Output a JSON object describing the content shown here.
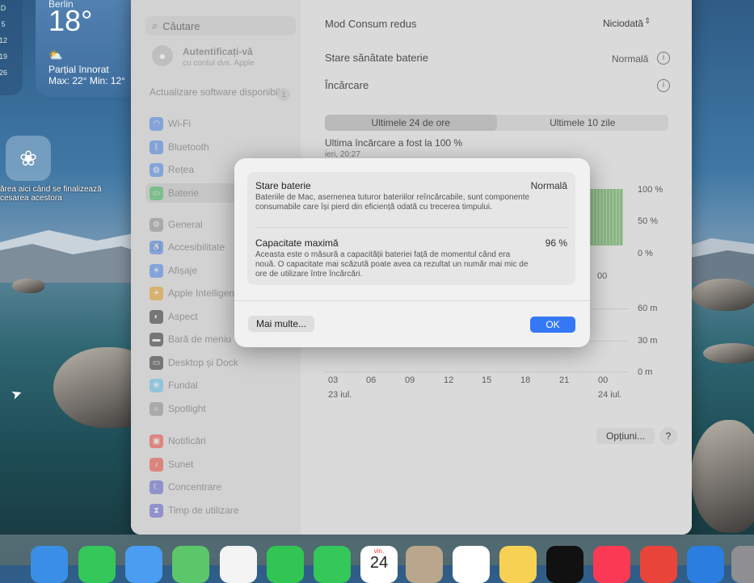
{
  "desktop": {
    "calendar_days": [
      "D",
      "5",
      "12",
      "19",
      "26"
    ],
    "weather": {
      "city": "Berlin",
      "temperature": "18°",
      "condition": "Parțial înnorat",
      "minmax": "Max: 22° Min: 12°"
    },
    "desktop_text_line1": "ărea aici când se finalizează",
    "desktop_text_line2": "cesarea acestora"
  },
  "sidebar": {
    "search_placeholder": "Căutare",
    "login_title": "Autentificați-vă",
    "login_subtitle": "cu contul dvs. Apple",
    "update_label": "Actualizare software disponibilă",
    "update_badge": "1",
    "items": [
      {
        "label": "Wi-Fi",
        "color": "#3b82f6",
        "glyph": "◠"
      },
      {
        "label": "Bluetooth",
        "color": "#3b82f6",
        "glyph": "ᛒ"
      },
      {
        "label": "Rețea",
        "color": "#3b82f6",
        "glyph": "◍"
      },
      {
        "label": "Baterie",
        "color": "#34c759",
        "glyph": "▭"
      },
      {
        "label": "General",
        "color": "#8e8e93",
        "glyph": "⚙"
      },
      {
        "label": "Accesibilitate",
        "color": "#3b82f6",
        "glyph": "♿"
      },
      {
        "label": "Afișaje",
        "color": "#3b82f6",
        "glyph": "☀"
      },
      {
        "label": "Apple Intelligence",
        "color": "#f59e0b",
        "glyph": "✦"
      },
      {
        "label": "Aspect",
        "color": "#1c1c1e",
        "glyph": "◐"
      },
      {
        "label": "Bară de meniu",
        "color": "#1c1c1e",
        "glyph": "▬"
      },
      {
        "label": "Desktop și Dock",
        "color": "#1c1c1e",
        "glyph": "▭"
      },
      {
        "label": "Fundal",
        "color": "#5ac8fa",
        "glyph": "❀"
      },
      {
        "label": "Spotlight",
        "color": "#8e8e93",
        "glyph": "⌕"
      },
      {
        "label": "Notificări",
        "color": "#ff3b30",
        "glyph": "▣"
      },
      {
        "label": "Sunet",
        "color": "#ff3b30",
        "glyph": "♪"
      },
      {
        "label": "Concentrare",
        "color": "#5856d6",
        "glyph": "☾"
      },
      {
        "label": "Timp de utilizare",
        "color": "#5856d6",
        "glyph": "⧗"
      }
    ]
  },
  "content": {
    "low_power_label": "Mod Consum redus",
    "low_power_value": "Niciodată",
    "health_label": "Stare sănătate baterie",
    "health_value": "Normală",
    "charging_label": "Încărcare",
    "tabs": [
      "Ultimele 24 de ore",
      "Ultimele 10 zile"
    ],
    "last_charge": "Ultima încărcare a fost la 100 %",
    "last_charge_time": "ieri, 20:27",
    "level_axis": [
      "100 %",
      "50 %",
      "0 %"
    ],
    "level_tick": "00",
    "usage_axis": [
      "60 m",
      "30 m",
      "0 m"
    ],
    "time_ticks": [
      "03",
      "06",
      "09",
      "12",
      "15",
      "18",
      "21",
      "00"
    ],
    "date_left": "23 iul.",
    "date_right": "24 iul.",
    "options_button": "Opțiuni...",
    "help_button": "?"
  },
  "dialog": {
    "battery_state_title": "Stare baterie",
    "battery_state_value": "Normală",
    "battery_state_desc": "Bateriile de Mac, asemenea tuturor bateriilor reîncărcabile, sunt componente consumabile care își pierd din eficiență odată cu trecerea timpului.",
    "max_capacity_title": "Capacitate maximă",
    "max_capacity_value": "96 %",
    "max_capacity_desc": "Aceasta este o măsură a capacității bateriei față de momentul când era nouă. O capacitate mai scăzută poate avea ca rezultat un număr mai mic de ore de utilizare între încărcări.",
    "more_button": "Mai multe...",
    "ok_button": "OK"
  },
  "dock": {
    "calendar_day_label": "vin.",
    "calendar_day_number": "24",
    "apps": [
      {
        "name": "safari-icon",
        "color": "#3a8ee6"
      },
      {
        "name": "messages-icon",
        "color": "#34c759"
      },
      {
        "name": "mail-icon",
        "color": "#4a9df0"
      },
      {
        "name": "maps-icon",
        "color": "#5cc76a"
      },
      {
        "name": "photos-icon",
        "color": "#f4f4f4"
      },
      {
        "name": "facetime-icon",
        "color": "#31c653"
      },
      {
        "name": "phone-icon",
        "color": "#34c759"
      },
      {
        "name": "calendar-icon",
        "color": "#ffffff"
      },
      {
        "name": "contacts-icon",
        "color": "#b9a68c"
      },
      {
        "name": "reminders-icon",
        "color": "#ffffff"
      },
      {
        "name": "notes-icon",
        "color": "#f7d154"
      },
      {
        "name": "tv-icon",
        "color": "#111111"
      },
      {
        "name": "music-icon",
        "color": "#fa3a55"
      },
      {
        "name": "rocket-icon",
        "color": "#e8443a"
      },
      {
        "name": "xcode-icon",
        "color": "#2b7de0"
      },
      {
        "name": "settings-icon",
        "color": "#8e8e93"
      }
    ]
  }
}
